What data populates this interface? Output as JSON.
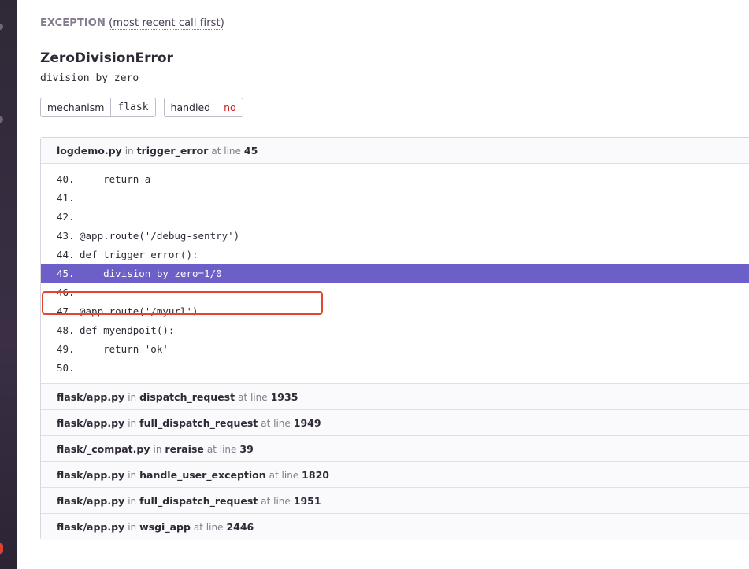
{
  "section": {
    "title": "EXCEPTION",
    "subtitle": "(most recent call first)"
  },
  "exception": {
    "type": "ZeroDivisionError",
    "value": "division by zero"
  },
  "tags": [
    {
      "key": "mechanism",
      "value": "flask"
    },
    {
      "key": "handled",
      "value": "no"
    }
  ],
  "labels": {
    "in": "in",
    "at_line": "at line"
  },
  "frames": [
    {
      "file": "logdemo.py",
      "function": "trigger_error",
      "line": "45"
    },
    {
      "file": "flask/app.py",
      "function": "dispatch_request",
      "line": "1935"
    },
    {
      "file": "flask/app.py",
      "function": "full_dispatch_request",
      "line": "1949"
    },
    {
      "file": "flask/_compat.py",
      "function": "reraise",
      "line": "39"
    },
    {
      "file": "flask/app.py",
      "function": "handle_user_exception",
      "line": "1820"
    },
    {
      "file": "flask/app.py",
      "function": "full_dispatch_request",
      "line": "1951"
    },
    {
      "file": "flask/app.py",
      "function": "wsgi_app",
      "line": "2446"
    }
  ],
  "code": [
    {
      "num": "40.",
      "text": "    return a"
    },
    {
      "num": "41.",
      "text": ""
    },
    {
      "num": "42.",
      "text": ""
    },
    {
      "num": "43.",
      "text": "@app.route('/debug-sentry')"
    },
    {
      "num": "44.",
      "text": "def trigger_error():"
    },
    {
      "num": "45.",
      "text": "    division_by_zero=1/0"
    },
    {
      "num": "46.",
      "text": ""
    },
    {
      "num": "47.",
      "text": "@app.route('/myurl')"
    },
    {
      "num": "48.",
      "text": "def myendpoit():"
    },
    {
      "num": "49.",
      "text": "    return 'ok'"
    },
    {
      "num": "50.",
      "text": ""
    }
  ],
  "colors": {
    "active_line": "#6c5fc7",
    "annotation": "#e0472f",
    "unhandled": "#e03e2f"
  }
}
